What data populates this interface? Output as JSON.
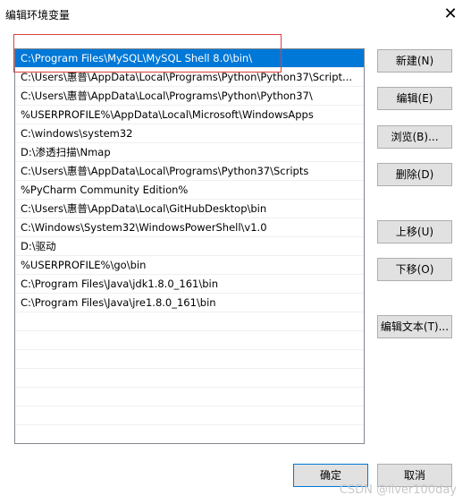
{
  "window": {
    "title": "编辑环境变量",
    "close_glyph": "✕"
  },
  "paths": [
    "C:\\Program Files\\MySQL\\MySQL Shell 8.0\\bin\\",
    "C:\\Users\\惠普\\AppData\\Local\\Programs\\Python\\Python37\\Script...",
    "C:\\Users\\惠普\\AppData\\Local\\Programs\\Python\\Python37\\",
    "%USERPROFILE%\\AppData\\Local\\Microsoft\\WindowsApps",
    "C:\\windows\\system32",
    "D:\\渗透扫描\\Nmap",
    "C:\\Users\\惠普\\AppData\\Local\\Programs\\Python37\\Scripts",
    "%PyCharm Community Edition%",
    "C:\\Users\\惠普\\AppData\\Local\\GitHubDesktop\\bin",
    "C:\\Windows\\System32\\WindowsPowerShell\\v1.0",
    "D:\\驱动",
    "%USERPROFILE%\\go\\bin",
    "C:\\Program Files\\Java\\jdk1.8.0_161\\bin",
    "C:\\Program Files\\Java\\jre1.8.0_161\\bin"
  ],
  "selected_index": 0,
  "buttons": {
    "new": "新建(N)",
    "edit": "编辑(E)",
    "browse": "浏览(B)...",
    "delete": "删除(D)",
    "move_up": "上移(U)",
    "move_down": "下移(O)",
    "edit_text": "编辑文本(T)...",
    "ok": "确定",
    "cancel": "取消"
  },
  "watermark": "CSDN @liver100day",
  "colors": {
    "selection": "#0078d7",
    "highlight_box": "#e04040"
  }
}
